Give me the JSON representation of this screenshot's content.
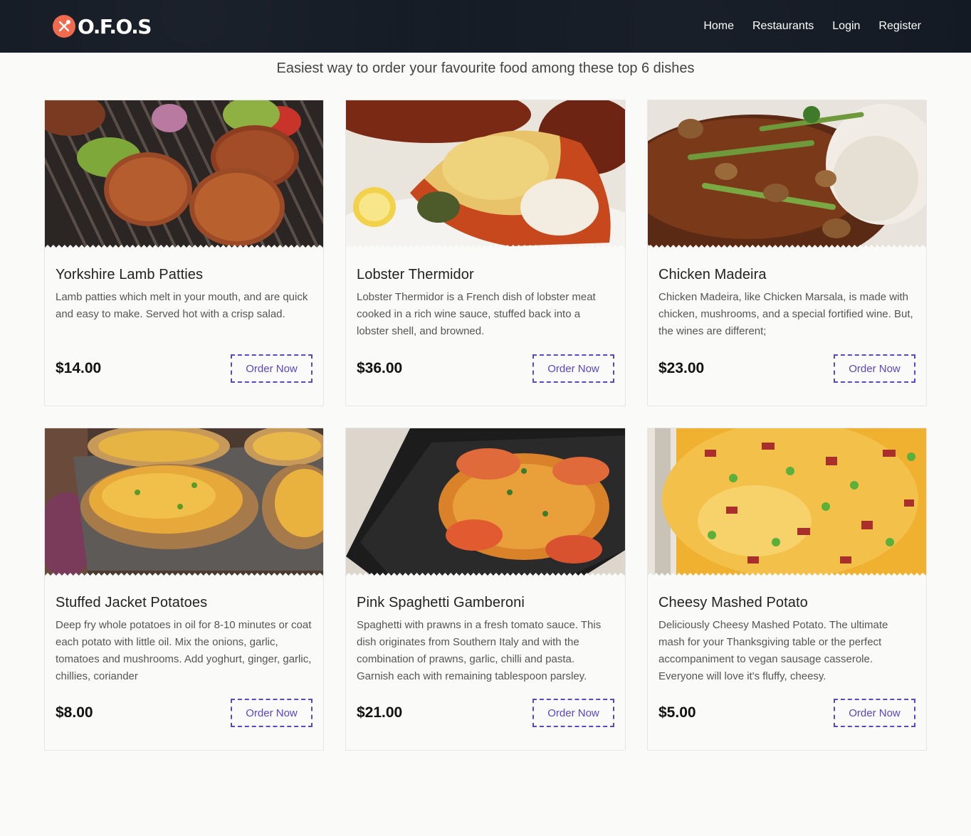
{
  "brand": {
    "name": "O.F.O.S",
    "logo_icon": "fork-spoon-icon",
    "accent": "#f06a4d"
  },
  "nav": [
    "Home",
    "Restaurants",
    "Login",
    "Register"
  ],
  "tagline": "Easiest way to order your favourite food among these top 6 dishes",
  "button_color": "#5b45c9",
  "dishes": [
    {
      "title": "Yorkshire Lamb Patties",
      "desc": "Lamb patties which melt in your mouth, and are quick and easy to make. Served hot with a crisp salad.",
      "price": "$14.00",
      "button": "Order Now",
      "image": "grilled-lamb-patties-photo"
    },
    {
      "title": "Lobster Thermidor",
      "desc": "Lobster Thermidor is a French dish of lobster meat cooked in a rich wine sauce, stuffed back into a lobster shell, and browned.",
      "price": "$36.00",
      "button": "Order Now",
      "image": "lobster-thermidor-photo"
    },
    {
      "title": "Chicken Madeira",
      "desc": "Chicken Madeira, like Chicken Marsala, is made with chicken, mushrooms, and a special fortified wine. But, the wines are different;",
      "price": "$23.00",
      "button": "Order Now",
      "image": "chicken-madeira-photo"
    },
    {
      "title": "Stuffed Jacket Potatoes",
      "desc": "Deep fry whole potatoes in oil for 8-10 minutes or coat each potato with little oil. Mix the onions, garlic, tomatoes and mushrooms. Add yoghurt, ginger, garlic, chillies, coriander",
      "price": "$8.00",
      "button": "Order Now",
      "image": "stuffed-jacket-potatoes-photo"
    },
    {
      "title": "Pink Spaghetti Gamberoni",
      "desc": "Spaghetti with prawns in a fresh tomato sauce. This dish originates from Southern Italy and with the combination of prawns, garlic, chilli and pasta. Garnish each with remaining tablespoon parsley.",
      "price": "$21.00",
      "button": "Order Now",
      "image": "spaghetti-prawns-photo"
    },
    {
      "title": "Cheesy Mashed Potato",
      "desc": "Deliciously Cheesy Mashed Potato. The ultimate mash for your Thanksgiving table or the perfect accompaniment to vegan sausage casserole. Everyone will love it's fluffy, cheesy.",
      "price": "$5.00",
      "button": "Order Now",
      "image": "cheesy-mashed-potato-photo"
    }
  ]
}
